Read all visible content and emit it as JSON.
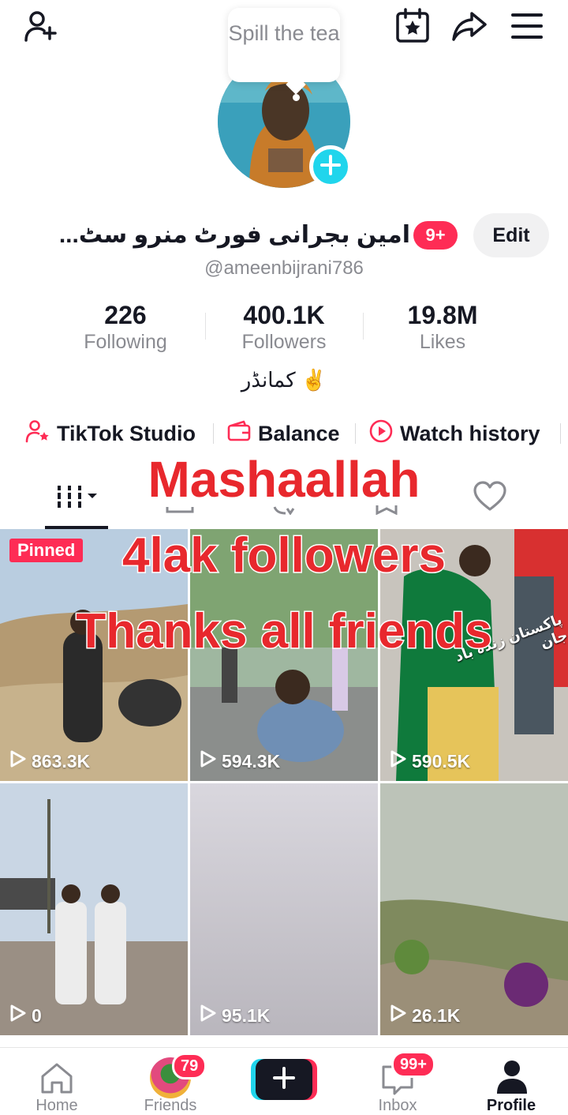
{
  "header": {
    "add_friend_icon": "person-plus-icon",
    "calendar_icon": "calendar-star-icon",
    "share_icon": "share-arrow-icon",
    "menu_icon": "hamburger-menu-icon"
  },
  "avatar": {
    "bubble_text": "Spill the tea",
    "add_icon": "plus-icon"
  },
  "profile": {
    "display_name": "امین بجرانی فورٹ منرو سٹ...",
    "notification_badge": "9+",
    "edit_label": "Edit",
    "username": "@ameenbijrani786",
    "bio": "کمانڈر ✌️"
  },
  "stats": [
    {
      "value": "226",
      "label": "Following"
    },
    {
      "value": "400.1K",
      "label": "Followers"
    },
    {
      "value": "19.8M",
      "label": "Likes"
    }
  ],
  "links": [
    {
      "label": "TikTok Studio",
      "icon": "person-star-icon"
    },
    {
      "label": "Balance",
      "icon": "wallet-icon"
    },
    {
      "label": "Watch history",
      "icon": "play-circle-icon"
    }
  ],
  "overlay": {
    "line1": "Mashaallah",
    "line2": "4lak followers",
    "line3": "Thanks all friends"
  },
  "videos": [
    {
      "views": "863.3K",
      "pinned": "Pinned"
    },
    {
      "views": "594.3K"
    },
    {
      "views": "590.5K",
      "overlay_text": "پاکستان زندہ باد جان"
    },
    {
      "views": "0"
    },
    {
      "views": "95.1K"
    },
    {
      "views": "26.1K"
    }
  ],
  "nav": {
    "home": "Home",
    "friends": "Friends",
    "friends_badge": "79",
    "inbox": "Inbox",
    "inbox_badge": "99+",
    "profile": "Profile"
  },
  "colors": {
    "accent_red": "#fe2c55",
    "accent_cyan": "#20d5ec",
    "caption_red": "#e8282d"
  }
}
